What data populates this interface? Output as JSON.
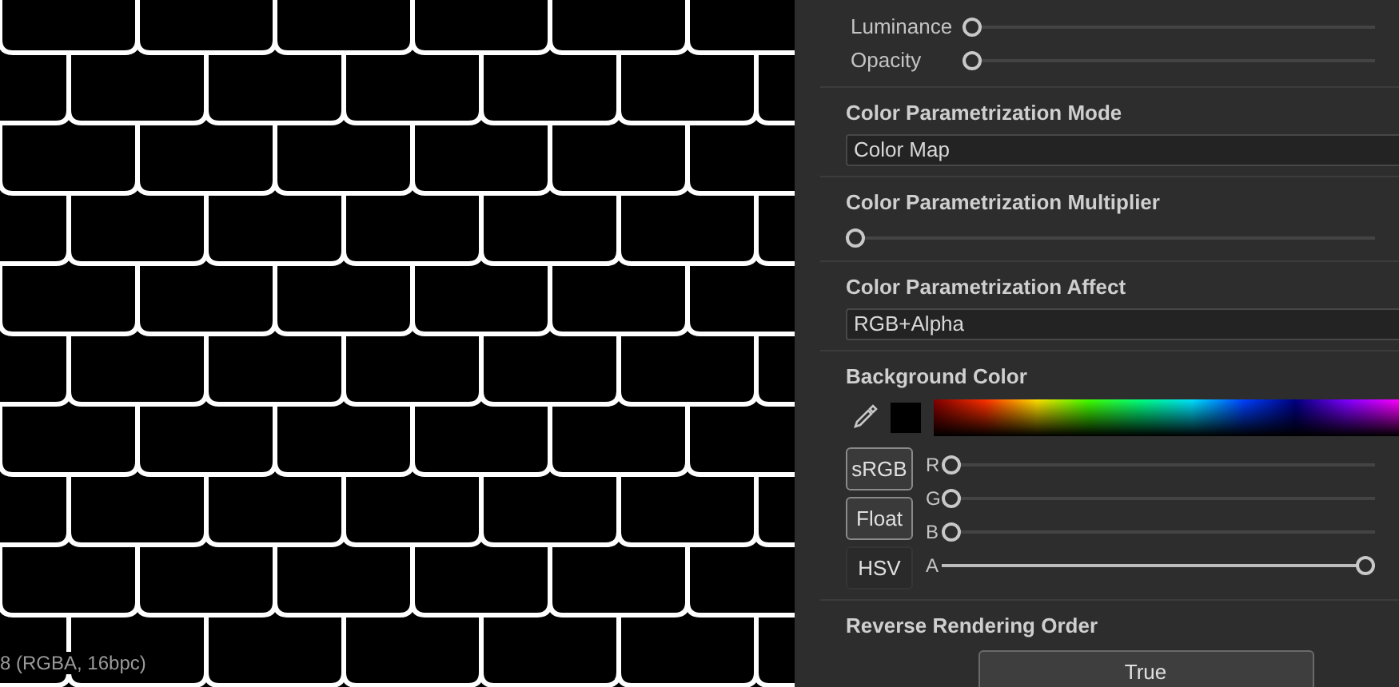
{
  "viewport": {
    "status_text": "8 (RGBA, 16bpc)"
  },
  "top_sliders": [
    {
      "label": "Luminance",
      "level": 0
    },
    {
      "label": "Opacity",
      "level": 0
    }
  ],
  "sections": [
    {
      "kind": "dropdown",
      "title": "Color Parametrization Mode",
      "value": "Color Map"
    },
    {
      "kind": "slider",
      "title": "Color Parametrization Multiplier",
      "level": 0
    },
    {
      "kind": "dropdown",
      "title": "Color Parametrization Affect",
      "value": "RGB+Alpha"
    },
    {
      "kind": "color",
      "title": "Background Color",
      "modes": [
        {
          "label": "sRGB",
          "on": true
        },
        {
          "label": "Float",
          "on": true
        },
        {
          "label": "HSV",
          "on": false
        }
      ],
      "channels": [
        {
          "label": "R",
          "level": 0
        },
        {
          "label": "G",
          "level": 0
        },
        {
          "label": "B",
          "level": 0
        },
        {
          "label": "A",
          "level": 1
        }
      ]
    },
    {
      "kind": "button",
      "title": "Reverse Rendering Order",
      "value": "True"
    }
  ]
}
